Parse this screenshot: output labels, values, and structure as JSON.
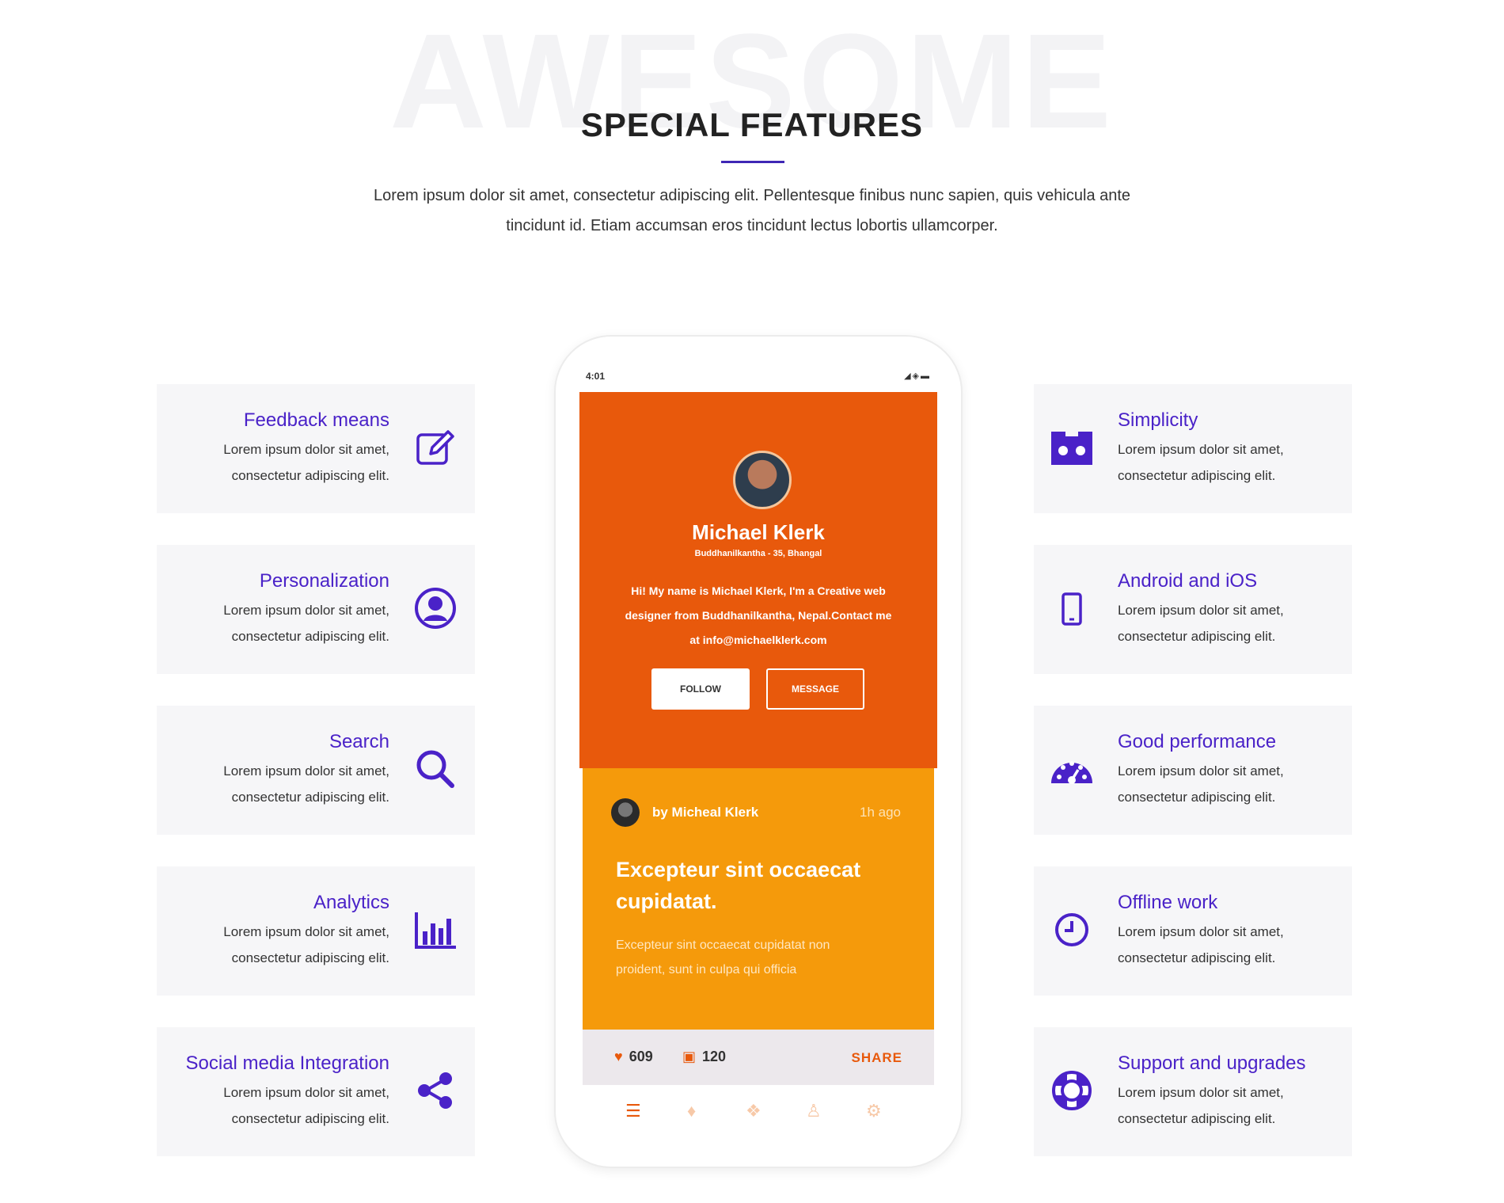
{
  "background_word": "AWESOME",
  "title": "SPECIAL FEATURES",
  "intro_line1": "Lorem ipsum dolor sit amet, consectetur adipiscing elit. Pellentesque finibus nunc sapien, quis vehicula ante",
  "intro_line2": "tincidunt id. Etiam accumsan eros tincidunt lectus lobortis ullamcorper.",
  "accent_color": "#4a22c8",
  "left_features": [
    {
      "title": "Feedback means",
      "desc1": "Lorem ipsum dolor sit amet,",
      "desc2": "consectetur adipiscing elit.",
      "icon": "edit-icon"
    },
    {
      "title": "Personalization",
      "desc1": "Lorem ipsum dolor sit amet,",
      "desc2": "consectetur adipiscing elit.",
      "icon": "user-circle-icon"
    },
    {
      "title": "Search",
      "desc1": "Lorem ipsum dolor sit amet,",
      "desc2": "consectetur adipiscing elit.",
      "icon": "search-icon"
    },
    {
      "title": "Analytics",
      "desc1": "Lorem ipsum dolor sit amet,",
      "desc2": "consectetur adipiscing elit.",
      "icon": "bar-chart-icon"
    },
    {
      "title": "Social media Integration",
      "desc1": "Lorem ipsum dolor sit amet,",
      "desc2": "consectetur adipiscing elit.",
      "icon": "share-icon"
    }
  ],
  "right_features": [
    {
      "title": "Simplicity",
      "desc1": "Lorem ipsum dolor sit amet,",
      "desc2": "consectetur adipiscing elit.",
      "icon": "cassette-icon"
    },
    {
      "title": "Android and iOS",
      "desc1": "Lorem ipsum dolor sit amet,",
      "desc2": "consectetur adipiscing elit.",
      "icon": "mobile-icon"
    },
    {
      "title": "Good performance",
      "desc1": "Lorem ipsum dolor sit amet,",
      "desc2": "consectetur adipiscing elit.",
      "icon": "speedometer-icon"
    },
    {
      "title": "Offline work",
      "desc1": "Lorem ipsum dolor sit amet,",
      "desc2": "consectetur adipiscing elit.",
      "icon": "clock-icon"
    },
    {
      "title": "Support and upgrades",
      "desc1": "Lorem ipsum dolor sit amet,",
      "desc2": "consectetur adipiscing elit.",
      "icon": "lifebuoy-icon"
    }
  ],
  "phone": {
    "status_time": "4:01",
    "profile_name": "Michael Klerk",
    "profile_location": "Buddhanilkantha - 35, Bhangal",
    "bio_line1": "Hi! My name is Michael Klerk, I'm a Creative web",
    "bio_line2": "designer from Buddhanilkantha, Nepal.Contact me",
    "bio_line3": "at info@michaelklerk.com",
    "follow_label": "FOLLOW",
    "message_label": "MESSAGE",
    "post_author": "by Micheal Klerk",
    "post_time": "1h ago",
    "post_title_line1": "Excepteur sint occaecat",
    "post_title_line2": "cupidatat.",
    "post_text_line1": "Excepteur sint occaecat cupidatat non",
    "post_text_line2": "proident, sunt in culpa qui officia",
    "likes": "609",
    "comments": "120",
    "share_label": "SHARE",
    "primary_color": "#e8590c",
    "card_color": "#f59a0b"
  }
}
